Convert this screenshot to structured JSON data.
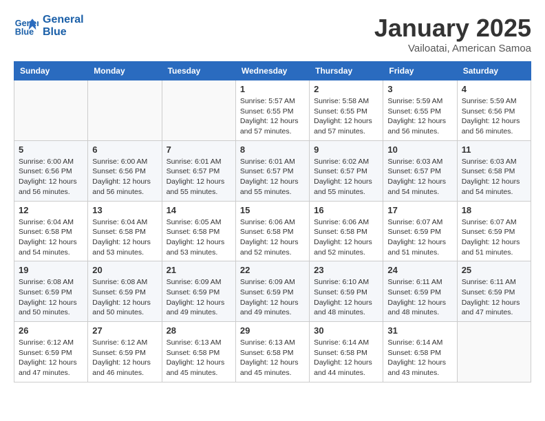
{
  "header": {
    "logo_line1": "General",
    "logo_line2": "Blue",
    "title": "January 2025",
    "subtitle": "Vailoatai, American Samoa"
  },
  "weekdays": [
    "Sunday",
    "Monday",
    "Tuesday",
    "Wednesday",
    "Thursday",
    "Friday",
    "Saturday"
  ],
  "weeks": [
    [
      {
        "day": "",
        "info": ""
      },
      {
        "day": "",
        "info": ""
      },
      {
        "day": "",
        "info": ""
      },
      {
        "day": "1",
        "info": "Sunrise: 5:57 AM\nSunset: 6:55 PM\nDaylight: 12 hours\nand 57 minutes."
      },
      {
        "day": "2",
        "info": "Sunrise: 5:58 AM\nSunset: 6:55 PM\nDaylight: 12 hours\nand 57 minutes."
      },
      {
        "day": "3",
        "info": "Sunrise: 5:59 AM\nSunset: 6:55 PM\nDaylight: 12 hours\nand 56 minutes."
      },
      {
        "day": "4",
        "info": "Sunrise: 5:59 AM\nSunset: 6:56 PM\nDaylight: 12 hours\nand 56 minutes."
      }
    ],
    [
      {
        "day": "5",
        "info": "Sunrise: 6:00 AM\nSunset: 6:56 PM\nDaylight: 12 hours\nand 56 minutes."
      },
      {
        "day": "6",
        "info": "Sunrise: 6:00 AM\nSunset: 6:56 PM\nDaylight: 12 hours\nand 56 minutes."
      },
      {
        "day": "7",
        "info": "Sunrise: 6:01 AM\nSunset: 6:57 PM\nDaylight: 12 hours\nand 55 minutes."
      },
      {
        "day": "8",
        "info": "Sunrise: 6:01 AM\nSunset: 6:57 PM\nDaylight: 12 hours\nand 55 minutes."
      },
      {
        "day": "9",
        "info": "Sunrise: 6:02 AM\nSunset: 6:57 PM\nDaylight: 12 hours\nand 55 minutes."
      },
      {
        "day": "10",
        "info": "Sunrise: 6:03 AM\nSunset: 6:57 PM\nDaylight: 12 hours\nand 54 minutes."
      },
      {
        "day": "11",
        "info": "Sunrise: 6:03 AM\nSunset: 6:58 PM\nDaylight: 12 hours\nand 54 minutes."
      }
    ],
    [
      {
        "day": "12",
        "info": "Sunrise: 6:04 AM\nSunset: 6:58 PM\nDaylight: 12 hours\nand 54 minutes."
      },
      {
        "day": "13",
        "info": "Sunrise: 6:04 AM\nSunset: 6:58 PM\nDaylight: 12 hours\nand 53 minutes."
      },
      {
        "day": "14",
        "info": "Sunrise: 6:05 AM\nSunset: 6:58 PM\nDaylight: 12 hours\nand 53 minutes."
      },
      {
        "day": "15",
        "info": "Sunrise: 6:06 AM\nSunset: 6:58 PM\nDaylight: 12 hours\nand 52 minutes."
      },
      {
        "day": "16",
        "info": "Sunrise: 6:06 AM\nSunset: 6:58 PM\nDaylight: 12 hours\nand 52 minutes."
      },
      {
        "day": "17",
        "info": "Sunrise: 6:07 AM\nSunset: 6:59 PM\nDaylight: 12 hours\nand 51 minutes."
      },
      {
        "day": "18",
        "info": "Sunrise: 6:07 AM\nSunset: 6:59 PM\nDaylight: 12 hours\nand 51 minutes."
      }
    ],
    [
      {
        "day": "19",
        "info": "Sunrise: 6:08 AM\nSunset: 6:59 PM\nDaylight: 12 hours\nand 50 minutes."
      },
      {
        "day": "20",
        "info": "Sunrise: 6:08 AM\nSunset: 6:59 PM\nDaylight: 12 hours\nand 50 minutes."
      },
      {
        "day": "21",
        "info": "Sunrise: 6:09 AM\nSunset: 6:59 PM\nDaylight: 12 hours\nand 49 minutes."
      },
      {
        "day": "22",
        "info": "Sunrise: 6:09 AM\nSunset: 6:59 PM\nDaylight: 12 hours\nand 49 minutes."
      },
      {
        "day": "23",
        "info": "Sunrise: 6:10 AM\nSunset: 6:59 PM\nDaylight: 12 hours\nand 48 minutes."
      },
      {
        "day": "24",
        "info": "Sunrise: 6:11 AM\nSunset: 6:59 PM\nDaylight: 12 hours\nand 48 minutes."
      },
      {
        "day": "25",
        "info": "Sunrise: 6:11 AM\nSunset: 6:59 PM\nDaylight: 12 hours\nand 47 minutes."
      }
    ],
    [
      {
        "day": "26",
        "info": "Sunrise: 6:12 AM\nSunset: 6:59 PM\nDaylight: 12 hours\nand 47 minutes."
      },
      {
        "day": "27",
        "info": "Sunrise: 6:12 AM\nSunset: 6:59 PM\nDaylight: 12 hours\nand 46 minutes."
      },
      {
        "day": "28",
        "info": "Sunrise: 6:13 AM\nSunset: 6:58 PM\nDaylight: 12 hours\nand 45 minutes."
      },
      {
        "day": "29",
        "info": "Sunrise: 6:13 AM\nSunset: 6:58 PM\nDaylight: 12 hours\nand 45 minutes."
      },
      {
        "day": "30",
        "info": "Sunrise: 6:14 AM\nSunset: 6:58 PM\nDaylight: 12 hours\nand 44 minutes."
      },
      {
        "day": "31",
        "info": "Sunrise: 6:14 AM\nSunset: 6:58 PM\nDaylight: 12 hours\nand 43 minutes."
      },
      {
        "day": "",
        "info": ""
      }
    ]
  ]
}
